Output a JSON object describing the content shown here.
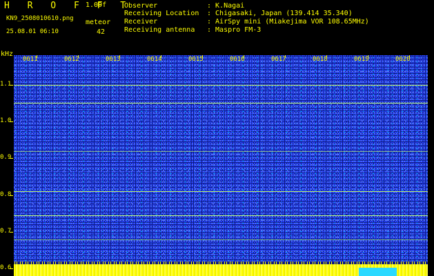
{
  "header": {
    "app_title": "H R O F F T",
    "version": "1.00f",
    "filename": "KN9_2508010610.png",
    "datetime": "25.08.01 06:10",
    "meteor_label": "meteor",
    "meteor_count": "42",
    "info": [
      {
        "key": "Observer",
        "value": ": K.Nagai"
      },
      {
        "key": "Receiving Location",
        "value": ": Chigasaki, Japan (139.414 35.340)"
      },
      {
        "key": "Receiver",
        "value": ": AirSpy mini (Miakejima VOR 108.65MHz)"
      },
      {
        "key": "Receiving antenna",
        "value": ": Maspro FM-3"
      }
    ]
  },
  "chart_data": {
    "type": "heatmap",
    "ylabel": "kHz",
    "ylim": [
      0.58,
      1.18
    ],
    "y_ticks": [
      "1.1",
      "1.0",
      "0.9",
      "0.8",
      "0.7",
      "0.6"
    ],
    "x_ticks": [
      "0611",
      "0612",
      "0613",
      "0614",
      "0615",
      "0616",
      "0617",
      "0618",
      "0619",
      "0620"
    ],
    "signal_lines_khz": [
      1.1,
      1.05,
      0.92,
      0.81,
      0.745,
      0.68,
      0.62,
      0.605
    ],
    "colors": {
      "background": "#0d1a82",
      "noise": "#2a45ff",
      "signal": "#c8ff6a",
      "labels": "#ffff00"
    }
  }
}
